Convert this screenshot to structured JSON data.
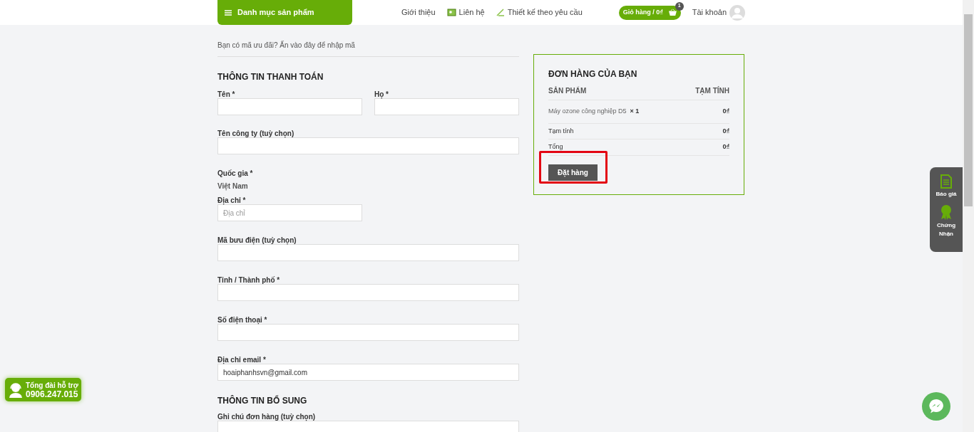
{
  "header": {
    "category_menu": "Danh mục sản phẩm",
    "nav": [
      {
        "kind": "plain",
        "label": "Giới thiệu"
      },
      {
        "kind": "contact",
        "label": "Liên hệ"
      },
      {
        "kind": "design",
        "label": "Thiết kế theo yêu cầu"
      }
    ],
    "cart": {
      "label": "Giỏ hàng / 0₫",
      "count": "1"
    },
    "account": "Tài khoản"
  },
  "coupon_notice": "Bạn có mã ưu đãi? Ấn vào đây để nhập mã",
  "billing": {
    "title": "THÔNG TIN THANH TOÁN",
    "fields": [
      {
        "kind": "pair",
        "items": [
          {
            "label": "Tên *"
          },
          {
            "label": "Họ *"
          }
        ]
      },
      {
        "kind": "input",
        "label": "Tên công ty (tuỳ chọn)"
      },
      {
        "kind": "static",
        "label": "Quốc gia *",
        "value": "Việt Nam"
      },
      {
        "kind": "short_input",
        "label": "Địa chỉ *",
        "placeholder": "Địa chỉ"
      },
      {
        "kind": "input",
        "label": "Mã bưu điện (tuỳ chọn)"
      },
      {
        "kind": "input",
        "label": "Tỉnh / Thành phố *"
      },
      {
        "kind": "input",
        "label": "Số điện thoại *"
      },
      {
        "kind": "input",
        "label": "Địa chỉ email *",
        "value": "hoaiphanhsvn@gmail.com"
      }
    ]
  },
  "additional": {
    "title": "THÔNG TIN BỔ SUNG",
    "notes_label": "Ghi chú đơn hàng (tuỳ chọn)"
  },
  "order": {
    "title": "ĐƠN HÀNG CỦA BẠN",
    "columns": [
      "SẢN PHẨM",
      "TẠM TÍNH"
    ],
    "items": [
      {
        "name": "Máy ozone công nghiệp D5",
        "qty": "× 1",
        "price": "0₫"
      }
    ],
    "totals": [
      {
        "label": "Tạm tính",
        "value": "0₫"
      },
      {
        "label": "Tổng",
        "value": "0₫"
      }
    ],
    "place_order": "Đặt hàng"
  },
  "side_widget": [
    {
      "kind": "quote",
      "label": "Báo giá"
    },
    {
      "kind": "certificate",
      "label": "Chứng Nhận"
    }
  ],
  "hotline": {
    "title": "Tổng đài hỗ trợ",
    "phone": "0906.247.015"
  }
}
